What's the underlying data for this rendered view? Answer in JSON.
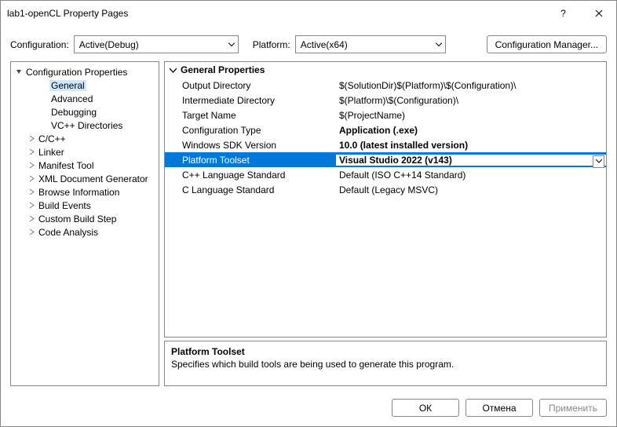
{
  "title": "lab1-openCL Property Pages",
  "topbar": {
    "config_label": "Configuration:",
    "config_value": "Active(Debug)",
    "platform_label": "Platform:",
    "platform_value": "Active(x64)",
    "manager_btn": "Configuration Manager..."
  },
  "tree": {
    "root": "Configuration Properties",
    "items": [
      {
        "label": "General",
        "selected": true,
        "indent": 2,
        "exp": ""
      },
      {
        "label": "Advanced",
        "indent": 2,
        "exp": ""
      },
      {
        "label": "Debugging",
        "indent": 2,
        "exp": ""
      },
      {
        "label": "VC++ Directories",
        "indent": 2,
        "exp": ""
      },
      {
        "label": "C/C++",
        "indent": 1,
        "exp": ">"
      },
      {
        "label": "Linker",
        "indent": 1,
        "exp": ">"
      },
      {
        "label": "Manifest Tool",
        "indent": 1,
        "exp": ">"
      },
      {
        "label": "XML Document Generator",
        "indent": 1,
        "exp": ">"
      },
      {
        "label": "Browse Information",
        "indent": 1,
        "exp": ">"
      },
      {
        "label": "Build Events",
        "indent": 1,
        "exp": ">"
      },
      {
        "label": "Custom Build Step",
        "indent": 1,
        "exp": ">"
      },
      {
        "label": "Code Analysis",
        "indent": 1,
        "exp": ">"
      }
    ]
  },
  "grid": {
    "group": "General Properties",
    "rows": [
      {
        "name": "Output Directory",
        "value": "$(SolutionDir)$(Platform)\\$(Configuration)\\"
      },
      {
        "name": "Intermediate Directory",
        "value": "$(Platform)\\$(Configuration)\\"
      },
      {
        "name": "Target Name",
        "value": "$(ProjectName)"
      },
      {
        "name": "Configuration Type",
        "value": "Application (.exe)",
        "bold": true
      },
      {
        "name": "Windows SDK Version",
        "value": "10.0 (latest installed version)",
        "bold": true
      },
      {
        "name": "Platform Toolset",
        "value": "Visual Studio 2022 (v143)",
        "bold": true,
        "selected": true,
        "dropdown": true
      },
      {
        "name": "C++ Language Standard",
        "value": "Default (ISO C++14 Standard)"
      },
      {
        "name": "C Language Standard",
        "value": "Default (Legacy MSVC)"
      }
    ]
  },
  "desc": {
    "title": "Platform Toolset",
    "text": "Specifies which build tools are being used to generate this program."
  },
  "footer": {
    "ok": "ОК",
    "cancel": "Отмена",
    "apply": "Применить"
  }
}
